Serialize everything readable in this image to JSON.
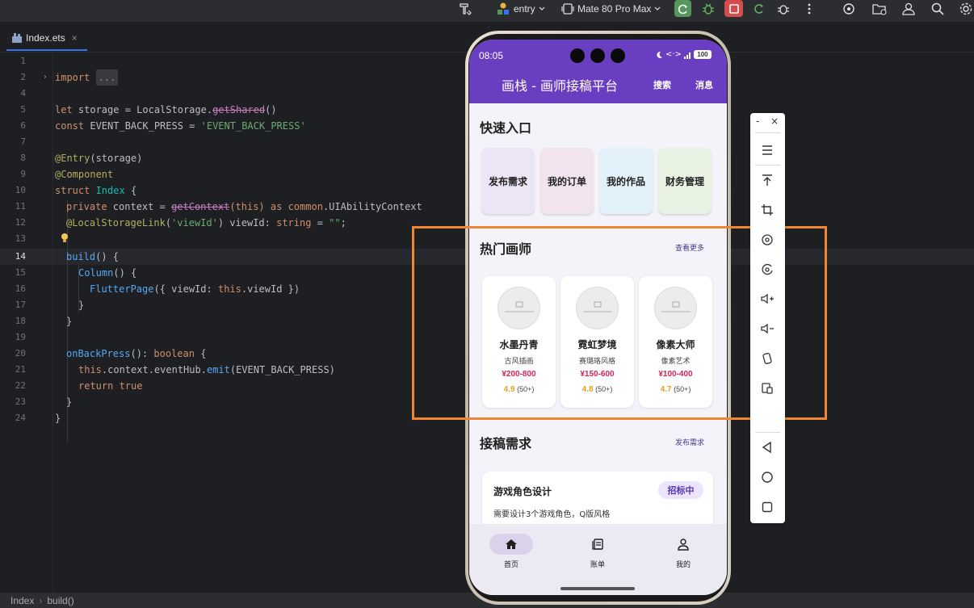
{
  "toolbar": {
    "module": "entry",
    "device": "Mate 80 Pro Max"
  },
  "editor": {
    "tab_name": "Index.ets",
    "tab_close": "×",
    "line_numbers": [
      "1",
      "2",
      "4",
      "5",
      "6",
      "7",
      "8",
      "9",
      "10",
      "11",
      "12",
      "13",
      "14",
      "15",
      "16",
      "17",
      "18",
      "19",
      "20",
      "21",
      "22",
      "23",
      "24"
    ],
    "fold_placeholder": "...",
    "tokens": {
      "import": "import",
      "let": "let",
      "storage": " storage = LocalStorage.",
      "getShared": "getShared",
      "paren": "()",
      "const": "const",
      "event_decl": " EVENT_BACK_PRESS = ",
      "event_str": "'EVENT_BACK_PRESS'",
      "entry": "@Entry",
      "entry_arg": "(storage)",
      "component": "@Component",
      "struct": "struct",
      "index_name": " Index",
      "brace_open": " {",
      "private": "private",
      "context_decl": " context = ",
      "getContext": "getContext",
      "this_paren": "(this)",
      "as": " as ",
      "common": "common",
      "ui_ctx": ".UIAbilityContext",
      "local_storage_link": "@LocalStorageLink",
      "link_arg_open": "(",
      "view_id_str": "'viewId'",
      "view_id_decl": ") viewId: ",
      "string_type": "string",
      "eq": " = ",
      "empty_str": "\"\"",
      "semi": ";",
      "build": "build",
      "build_rest": "() {",
      "column": "Column",
      "column_rest": "() {",
      "flutter": "FlutterPage",
      "flutter_rest_a": "({ viewId: ",
      "this_kw": "this",
      "flutter_rest_b": ".viewId })",
      "close_brace": "}",
      "on_back": "onBackPress",
      "on_back_rest": "(): ",
      "boolean": "boolean",
      "on_back_brace": " {",
      "emit_line": ".context.eventHub.",
      "emit": "emit",
      "emit_arg": "(EVENT_BACK_PRESS)",
      "return": "return",
      "true_kw": " true"
    }
  },
  "status_bar": {
    "crumb1": "Index",
    "separator": "›",
    "crumb2": "build()"
  },
  "phone": {
    "time": "08:05",
    "network": "<·>",
    "battery": "100",
    "app_title": "画栈 - 画师接稿平台",
    "search": "搜索",
    "messages": "消息",
    "quick_title": "快速入口",
    "quick_items": [
      "发布需求",
      "我的订单",
      "我的作品",
      "财务管理"
    ],
    "quick_colors": [
      "#ece5f5",
      "#f1e4ef",
      "#e3f1fa",
      "#e7f2e3"
    ],
    "hot_title": "热门画师",
    "see_more": "查看更多",
    "artists": [
      {
        "name": "水墨丹青",
        "style": "古风插画",
        "price": "¥200-800",
        "score": "4.9",
        "count": "(50+)"
      },
      {
        "name": "霓虹梦境",
        "style": "赛璐珞风格",
        "price": "¥150-600",
        "score": "4.8",
        "count": "(50+)"
      },
      {
        "name": "像素大师",
        "style": "像素艺术",
        "price": "¥100-400",
        "score": "4.7",
        "count": "(50+)"
      }
    ],
    "req_title": "接稿需求",
    "post_req": "发布需求",
    "request": {
      "title": "游戏角色设计",
      "badge": "招标中",
      "desc": "需要设计3个游戏角色，Q版风格"
    },
    "nav": [
      "首页",
      "账单",
      "我的"
    ]
  },
  "emulator_toolbar": {
    "minimize": "-",
    "close": "×"
  },
  "colors": {
    "accent_purple": "#6a3ec0",
    "highlight_orange": "#f08632",
    "price_red": "#d6245a",
    "rating_orange": "#e8a020"
  }
}
